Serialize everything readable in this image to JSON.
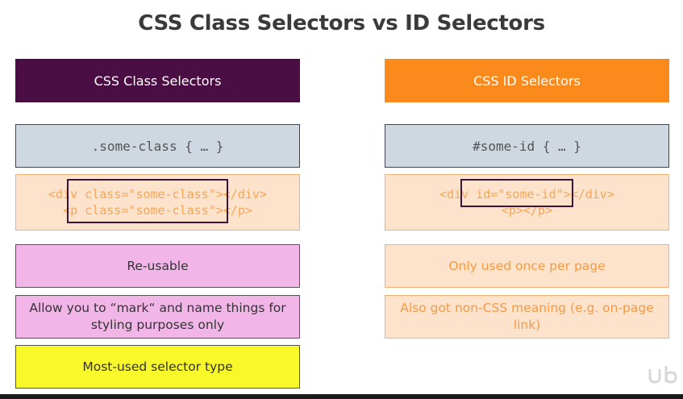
{
  "title": "CSS Class Selectors vs ID Selectors",
  "left": {
    "header": "CSS Class Selectors",
    "selector": ".some-class { … }",
    "html_lines": [
      "<div class=\"some-class\"></div>",
      "<p class=\"some-class\"></p>"
    ],
    "points": [
      "Re-usable",
      "Allow you to “mark“ and name things for styling purposes only",
      "Most-used selector type"
    ]
  },
  "right": {
    "header": "CSS ID Selectors",
    "selector": "#some-id { … }",
    "html_lines": [
      "<div id=\"some-id\"></div>",
      "<p></p>"
    ],
    "points": [
      "Only used once per page",
      "Also got non-CSS meaning (e.g. on-page link)"
    ]
  },
  "colors": {
    "class_header": "#4b0e44",
    "id_header": "#fb8a1d",
    "selector_box": "#cfd8e1",
    "html_box": "#fde3cc",
    "pink_box": "#f2b5e8",
    "yellow_box": "#f8f82a"
  },
  "icons": {
    "watermark": "udemy-logo-icon"
  }
}
